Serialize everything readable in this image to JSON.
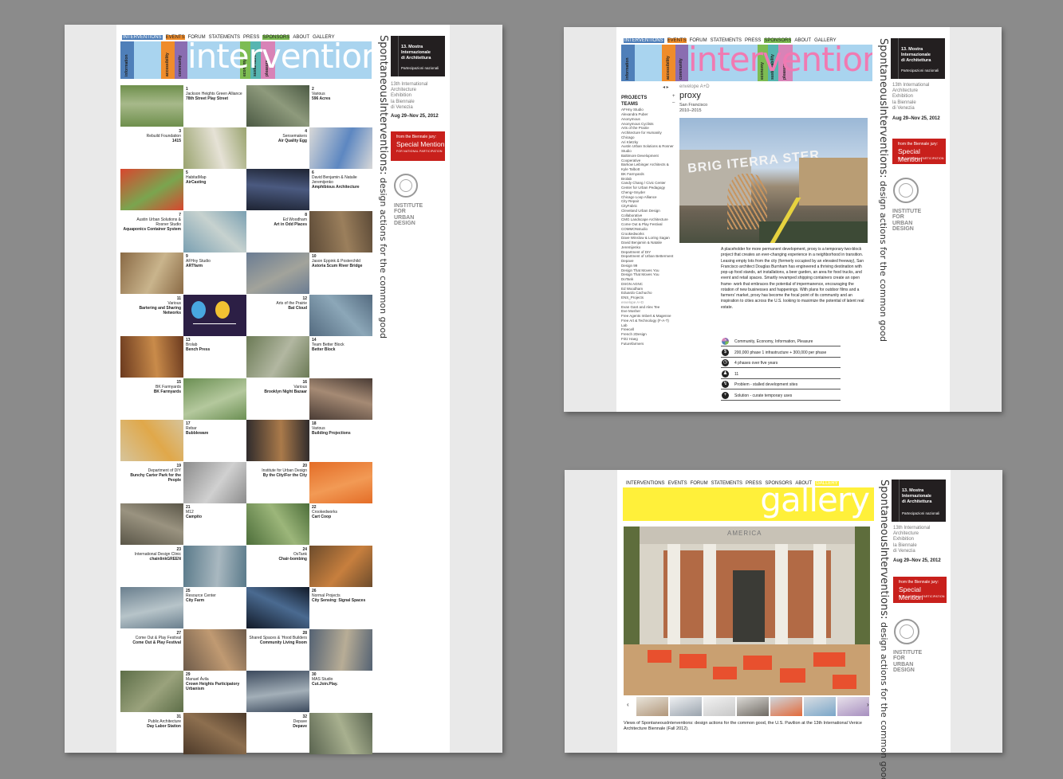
{
  "nav": [
    "INTERVENTIONS",
    "EVENTS",
    "FORUM",
    "STATEMENTS",
    "PRESS",
    "SPONSORS",
    "ABOUT",
    "GALLERY"
  ],
  "banner_word": "interventions",
  "gallery_word": "gallery",
  "tag_left": [
    "information",
    "accessibility",
    "community"
  ],
  "tag_right": [
    "economy",
    "sustainability",
    "pleasure"
  ],
  "side": {
    "title_a": "Spontaneous",
    "title_b": "Interventions:",
    "title_c": " design actions for the common good",
    "biennale_label": "la Biennale di Venezia",
    "biennale_1": "13. Mostra",
    "biennale_2": "Internazionale",
    "biennale_3": "di Architettura",
    "biennale_4": "Partecipazioni nazionali",
    "exh": [
      "13th International",
      "Architecture",
      "Exhibition",
      "la Biennale",
      "di Venezia"
    ],
    "dates": "Aug 29–Nov 25, 2012",
    "mention_a": "from the Biennale jury:",
    "mention_b": "Special Mention",
    "mention_c": "FOR NATIONAL PARTICIPATION",
    "iud": [
      "INSTITUTE",
      "FOR",
      "URBAN",
      "DESIGN"
    ]
  },
  "projects": [
    {
      "n": "1",
      "who": "Jackson Heights Green Alliance",
      "title": "78th Street Play Street"
    },
    {
      "n": "2",
      "who": "Various",
      "title": "596 Acres"
    },
    {
      "n": "3",
      "who": "Rebuild Foundation",
      "title": "1415"
    },
    {
      "n": "4",
      "who": "Sensemakers",
      "title": "Air Quality Egg"
    },
    {
      "n": "5",
      "who": "HabitatMap",
      "title": "AirCasting"
    },
    {
      "n": "6",
      "who": "David Benjamin & Natalie Jeremijenko",
      "title": "Amphibious Architecture"
    },
    {
      "n": "7",
      "who": "Austin Urban Solutions & Rosner Studio",
      "title": "Aquaponics Container System"
    },
    {
      "n": "8",
      "who": "Ed Woodham",
      "title": "Art in Odd Places"
    },
    {
      "n": "9",
      "who": "AFHny Studio",
      "title": "ARTfarm"
    },
    {
      "n": "10",
      "who": "Jason Eppink & Posterchild",
      "title": "Astoria Scum River Bridge"
    },
    {
      "n": "11",
      "who": "Various",
      "title": "Bartering and Sharing Networks"
    },
    {
      "n": "12",
      "who": "Arts of the Prairie",
      "title": "Bat Cloud"
    },
    {
      "n": "13",
      "who": "Brolab",
      "title": "Bench Press"
    },
    {
      "n": "14",
      "who": "Team Better Block",
      "title": "Better Block"
    },
    {
      "n": "15",
      "who": "BK Farmyards",
      "title": "BK Farmyards"
    },
    {
      "n": "16",
      "who": "Various",
      "title": "Brooklyn Night Bazaar"
    },
    {
      "n": "17",
      "who": "Rebar",
      "title": "Bubbleware"
    },
    {
      "n": "18",
      "who": "Various",
      "title": "Building Projections"
    },
    {
      "n": "19",
      "who": "Department of DIY",
      "title": "Bunchy Carter Park for the People"
    },
    {
      "n": "20",
      "who": "Institute for Urban Design",
      "title": "By the City/For the City"
    },
    {
      "n": "21",
      "who": "M12",
      "title": "Campito"
    },
    {
      "n": "22",
      "who": "Crookedworks",
      "title": "Cart Coop"
    },
    {
      "n": "23",
      "who": "International Design Clinic",
      "title": "chainlinkGREEN"
    },
    {
      "n": "24",
      "who": "OsTank",
      "title": "Chair-bombing"
    },
    {
      "n": "25",
      "who": "Resource Center",
      "title": "City Farm"
    },
    {
      "n": "26",
      "who": "Normal Projects",
      "title": "City Sensing: Signal Spaces"
    },
    {
      "n": "27",
      "who": "Come Out & Play Festival",
      "title": "Come Out & Play Festival"
    },
    {
      "n": "28",
      "who": "Shared Spaces & 'Hood Builders",
      "title": "Community Living Room"
    },
    {
      "n": "29",
      "who": "Manuel Ávila",
      "title": "Crown Heights Participatory Urbanism"
    },
    {
      "n": "30",
      "who": "MAS Studio",
      "title": "Cut.Join.Play."
    },
    {
      "n": "31",
      "who": "Public Architecture",
      "title": "Day Labor Station"
    },
    {
      "n": "32",
      "who": "Depave",
      "title": "Depave"
    }
  ],
  "proxy": {
    "breadcrumb": "envelope A+D",
    "title": "proxy",
    "location": "San Francisco",
    "years": "2010–2015",
    "projects_label": "PROJECTS",
    "teams_label": "TEAMS",
    "plus": "+",
    "minus": "–",
    "teams": [
      "AFHny Studio",
      "Alexandra Puber",
      "Anonymous",
      "Anonymous Cyclists",
      "Arts of the Prairie",
      "Architecture for Humanity Chicago",
      "Ari Kletzky",
      "Austin Urban Solutions & Rosner Studio",
      "Baltimore Development Cooperative",
      "Barkow Leibinger Architects & Kyle Talbott",
      "BK Farmyards",
      "Brolab",
      "Candy Chang / Civic Center",
      "Center for Urban Pedagogy",
      "Cheng+Snyder",
      "Chicago Loop Alliance",
      "City Repair",
      "CityFabric",
      "Cleveland Urban Design Collaborative",
      "CMG Landscape Architecture",
      "Come Out & Play Festival",
      "COMMONstudio",
      "Crookedworks",
      "Dave Winslow & Loring Sagan",
      "David Benjamin & Natalie Jeremijenko",
      "Department of DIY",
      "Department of Urban Betterment",
      "Depave",
      "Design 99",
      "Design That Moves You",
      "Design That Moves You",
      "DoTank",
      "DSGN AGNC",
      "Ed Woodham",
      "Eduardo Cachucho",
      "ENS_Projects",
      "envelope A+D",
      "Evan Gant and Alex Tee",
      "Eve Mosher",
      "Free Agents Imbert & Magenne",
      "Free Art & Technology (F-A-T) Lab",
      "Freecell",
      "French 2Design",
      "Fritz Haeg",
      "Futurefarmers"
    ],
    "desc": "A placeholder for more permanent development, proxy is a temporary two-block project that creates an ever-changing experience in a neighborhood in transition. Leasing empty lots from the city (formerly occupied by an elevated freeway), San Francisco architect Douglas Burnham has engineered a thriving destination with pop-up food stands, art installations, a beer garden, an area for food trucks, and event and retail spaces. Smartly revamped shipping containers create an open frame- work that embraces the potential of impermanence, encouraging the rotation of new businesses and happenings. With plans for outdoor films and a farmers' market, proxy has become the focal point of its community and an inspiration to cities across the U.S. looking to maximize the potential of latent real estate.",
    "facts": [
      {
        "icon": "tags-icon",
        "glyph": "◔",
        "text": "Community, Economy, Information, Pleasure"
      },
      {
        "icon": "cost-icon",
        "glyph": "$",
        "text": "200,000 phase 1 infrastructure + 300,000 per phase"
      },
      {
        "icon": "time-icon",
        "glyph": "◷",
        "text": "4 phases over five years"
      },
      {
        "icon": "people-icon",
        "glyph": "♟",
        "text": "11"
      },
      {
        "icon": "problem-icon",
        "glyph": "↯",
        "text": "Problem - stalled development sites"
      },
      {
        "icon": "solution-icon",
        "glyph": "+",
        "text": "Solution - curate temporary uses"
      }
    ],
    "photo_sign": "BRIG ITERRA STER"
  },
  "gallery": {
    "building_label": "AMERICA",
    "prev": "‹",
    "next": "›",
    "caption": "Views of SpontaneousInterventions: design actions for the common good, the U.S. Pavilion at the 13th International Venice Architecture Biennale (Fall 2012).",
    "thumbs": 7
  },
  "colors": {
    "banner_blue": "#a9d4ef",
    "strip_blue": "#4f7fb9",
    "strip_orange": "#ef8c2a",
    "strip_purple": "#8a6db1",
    "strip_green": "#7dbc52",
    "strip_teal": "#56b5b1",
    "strip_pink": "#d883b7",
    "word_pink": "#f07ab2",
    "gallery_yellow": "#fff03a",
    "special_red": "#c8201c"
  }
}
